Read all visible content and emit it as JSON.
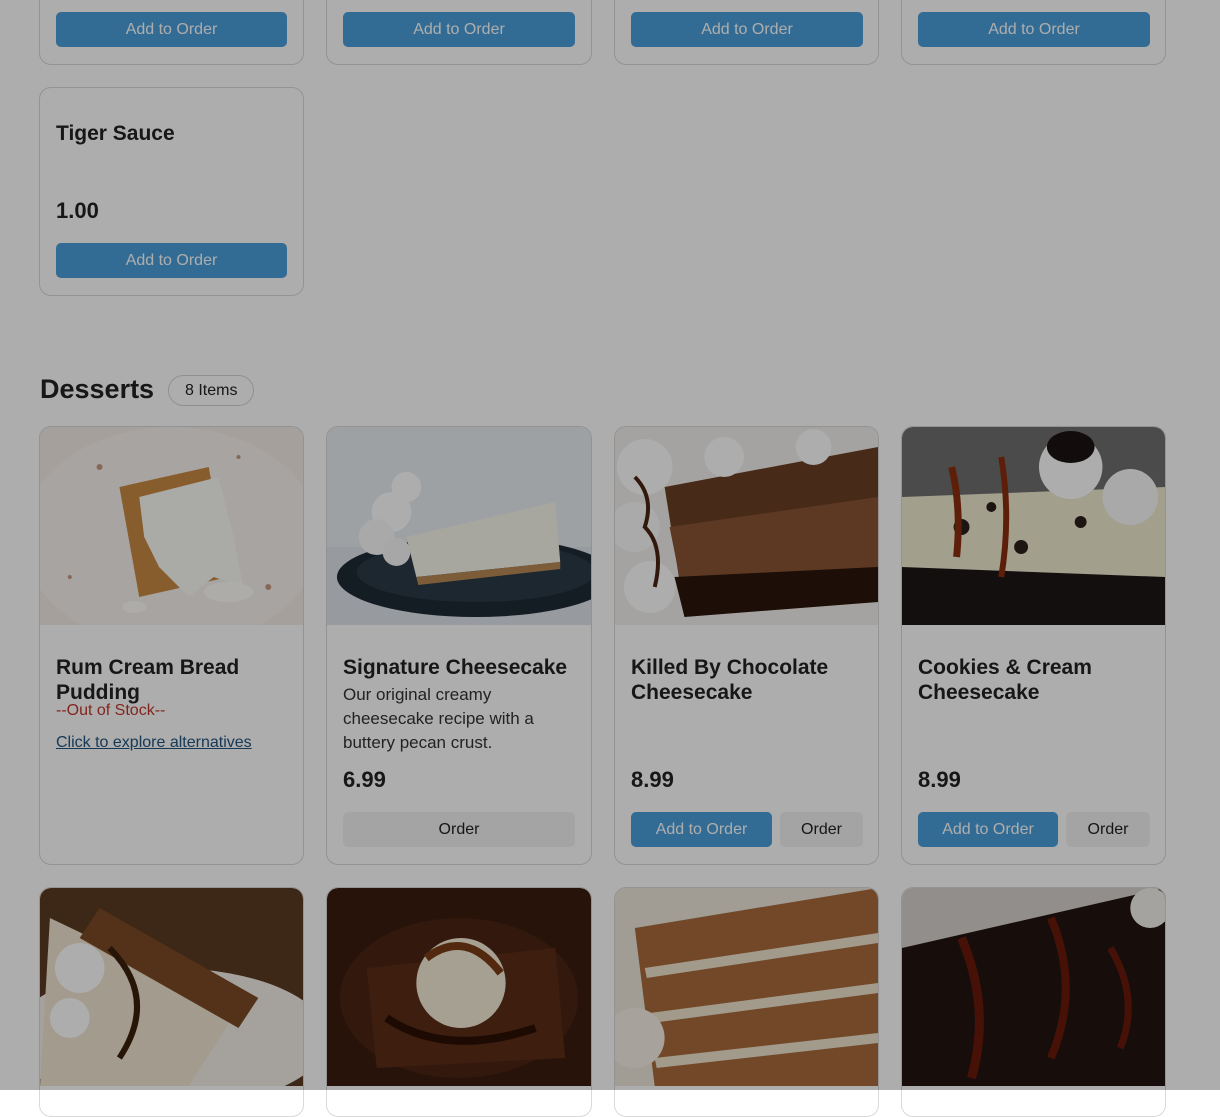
{
  "previous_section": {
    "top_row_buttons": [
      "Add to Order",
      "Add to Order",
      "Add to Order",
      "Add to Order"
    ],
    "tiger_sauce": {
      "name": "Tiger Sauce",
      "price": "1.00",
      "button": "Add to Order"
    }
  },
  "desserts": {
    "title": "Desserts",
    "count": "8 Items",
    "items": [
      {
        "name": "Rum Cream Bread Pudding",
        "status": "--Out of Stock--",
        "link": "Click to explore alternatives",
        "image": "bread-pudding-photo"
      },
      {
        "name": "Signature Cheesecake",
        "description": "Our original creamy cheesecake recipe with a buttery pecan crust.",
        "price": "6.99",
        "order": "Order",
        "image": "cheesecake-photo"
      },
      {
        "name": "Killed By Chocolate Cheesecake",
        "price": "8.99",
        "add": "Add to Order",
        "order": "Order",
        "image": "chocolate-cheesecake-photo"
      },
      {
        "name": "Cookies & Cream Cheesecake",
        "price": "8.99",
        "add": "Add to Order",
        "order": "Order",
        "image": "cookies-cream-cheesecake-photo"
      },
      {
        "image": "turtle-cheesecake-photo"
      },
      {
        "image": "brownie-sundae-photo"
      },
      {
        "image": "carrot-cake-photo"
      },
      {
        "image": "chocolate-cake-photo"
      }
    ]
  },
  "colors": {
    "primary": "#4a9fdc",
    "out_of_stock": "#c0392b",
    "link": "#23557e",
    "overlay": "rgba(0,0,0,0.32)"
  }
}
